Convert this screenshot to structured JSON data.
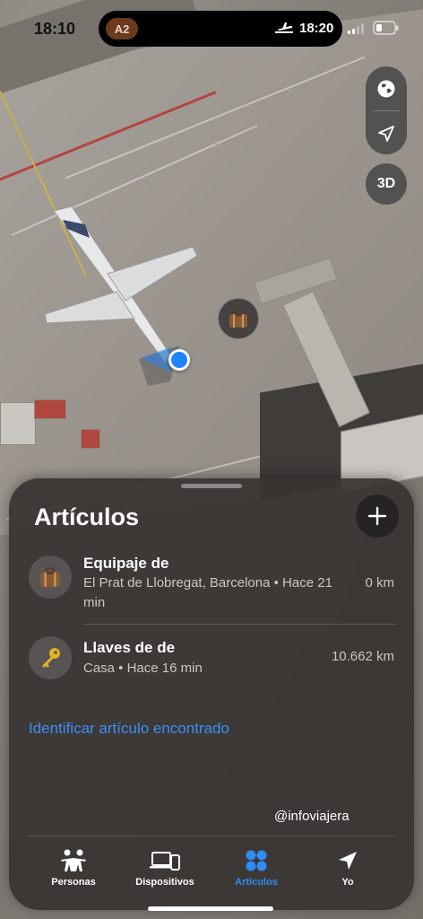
{
  "status_bar": {
    "time": "18:10",
    "island_badge": "A2",
    "island_time": "18:20"
  },
  "map": {
    "controls": {
      "globe_icon": "globe-icon",
      "location_icon": "location-arrow-icon",
      "view_3d_label": "3D"
    },
    "item_marker_icon": "suitcase-icon"
  },
  "sheet": {
    "title": "Artículos",
    "add_icon": "plus-icon",
    "items": [
      {
        "name": "Equipaje de",
        "location": "El Prat de Llobregat, Barcelona • Hace 21 min",
        "distance": "0 km",
        "icon": "suitcase-icon"
      },
      {
        "name": "Llaves de de",
        "location": "Casa • Hace 16 min",
        "distance": "10.662 km",
        "icon": "key-icon"
      }
    ],
    "identify_link": "Identificar artículo encontrado",
    "watermark": "@infoviajera"
  },
  "tabbar": {
    "tabs": [
      {
        "label": "Personas",
        "icon": "people-icon",
        "active": false
      },
      {
        "label": "Dispositivos",
        "icon": "devices-icon",
        "active": false
      },
      {
        "label": "Artículos",
        "icon": "items-grid-icon",
        "active": true
      },
      {
        "label": "Yo",
        "icon": "me-arrow-icon",
        "active": false
      }
    ]
  },
  "colors": {
    "accent": "#2f8cf6",
    "link": "#3d8ef7",
    "user_dot": "#1e84ff"
  }
}
